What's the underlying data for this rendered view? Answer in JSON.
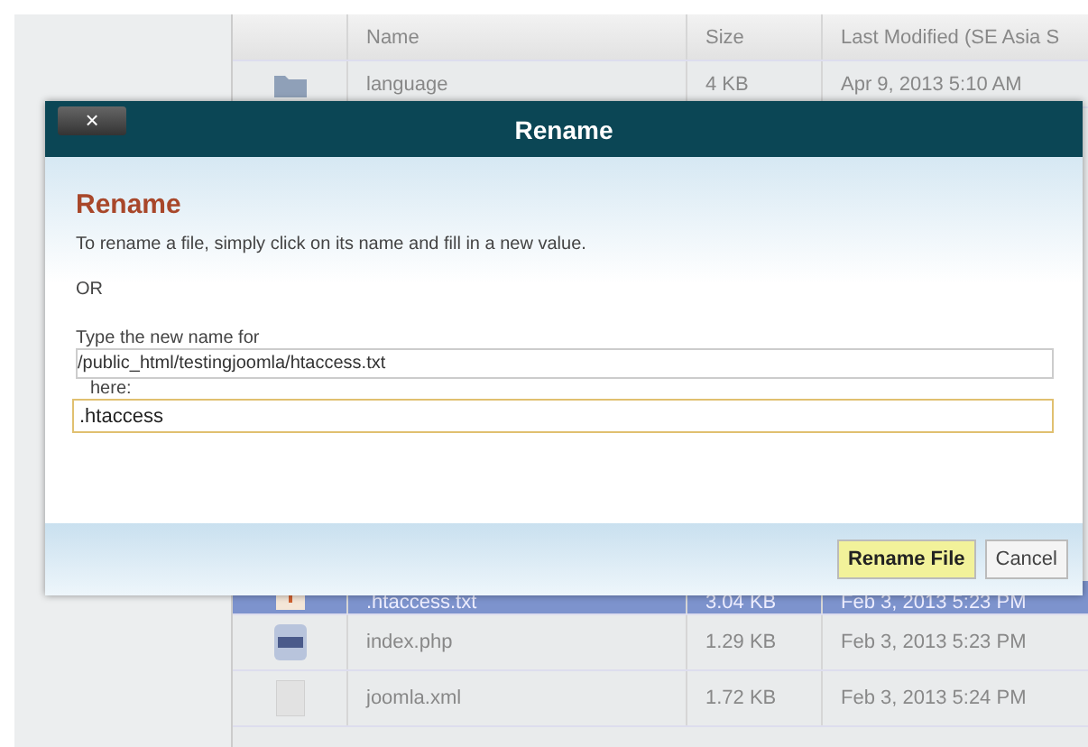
{
  "table": {
    "columns": [
      "Name",
      "Size",
      "Last Modified (SE Asia S"
    ],
    "rows": [
      {
        "kind": "folder",
        "name": "language",
        "size": "4 KB",
        "modified": "Apr 9, 2013 5:10 AM",
        "selected": false
      },
      {
        "kind": "text",
        "name": ".htaccess.txt",
        "size": "3.04 KB",
        "modified": "Feb 3, 2013 5:23 PM",
        "selected": true
      },
      {
        "kind": "php",
        "name": "index.php",
        "size": "1.29 KB",
        "modified": "Feb 3, 2013 5:23 PM",
        "selected": false
      },
      {
        "kind": "file",
        "name": "joomla.xml",
        "size": "1.72 KB",
        "modified": "Feb 3, 2013 5:24 PM",
        "selected": false
      }
    ]
  },
  "dialog": {
    "title": "Rename",
    "close": "×",
    "heading": "Rename",
    "instruction": "To rename a file, simply click on its name and fill in a new value.",
    "or": "OR",
    "prompt": "Type the new name for",
    "path": "/public_html/testingjoomla/htaccess.txt",
    "here": "here:",
    "new_name": ".htaccess",
    "buttons": [
      "Rename File",
      "Cancel"
    ]
  }
}
